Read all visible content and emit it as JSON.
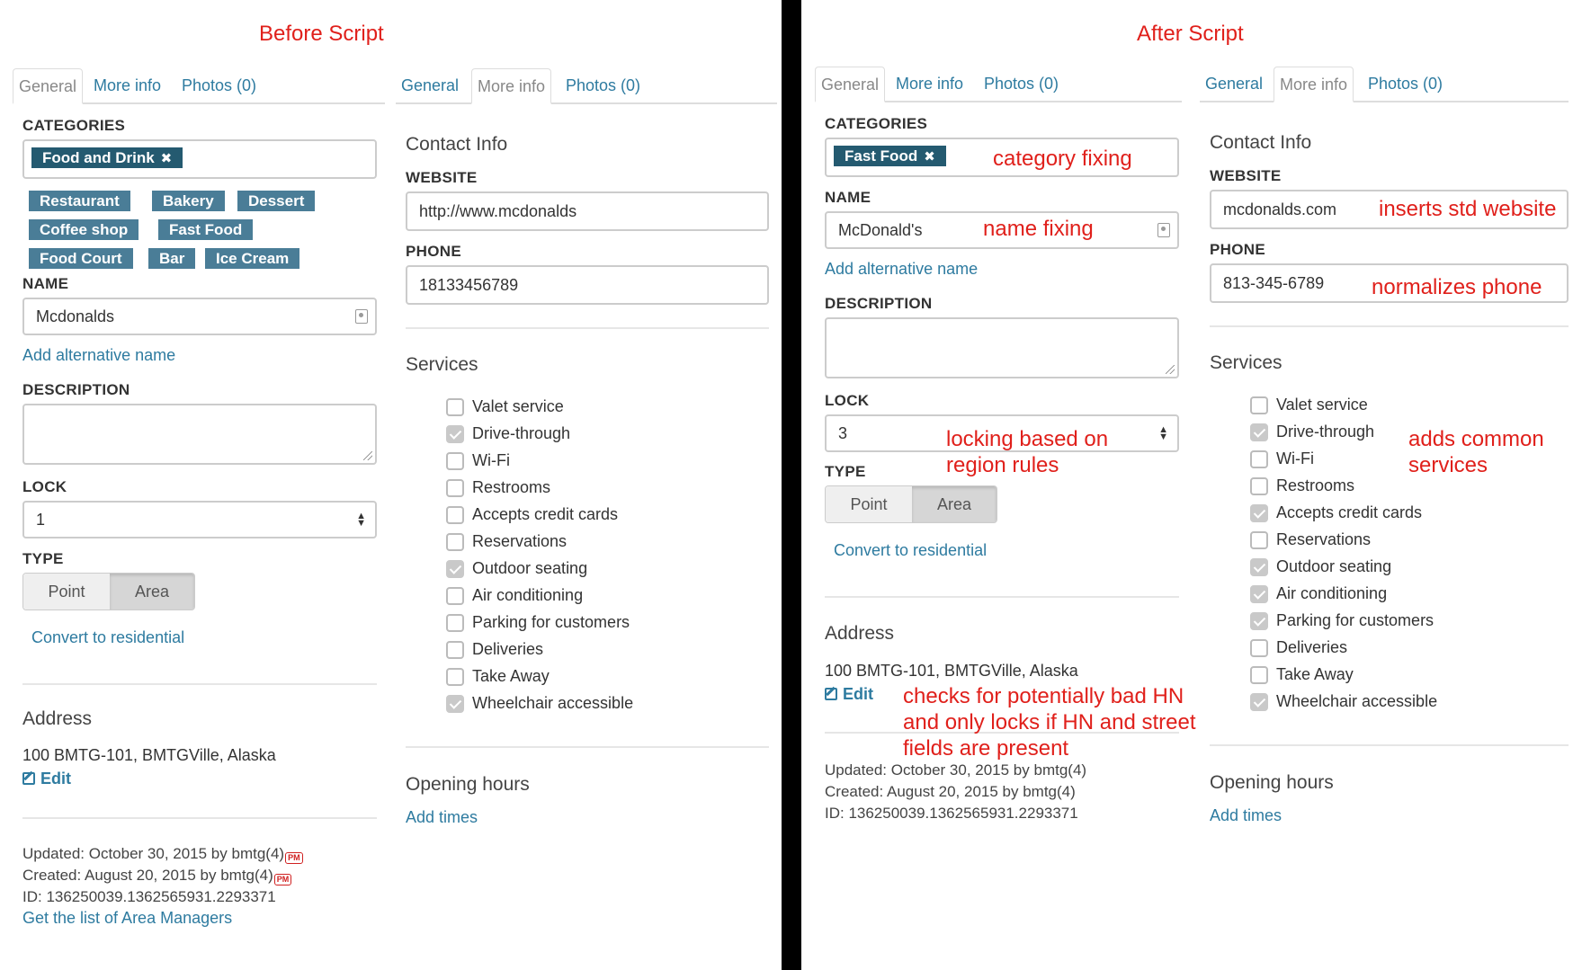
{
  "before": {
    "title": "Before Script",
    "general": {
      "tabs": [
        "General",
        "More info",
        "Photos (0)"
      ],
      "categories_label": "CATEGORIES",
      "selected_category": "Food and Drink",
      "suggestions": [
        "Restaurant",
        "Bakery",
        "Dessert",
        "Coffee shop",
        "Fast Food",
        "Food Court",
        "Bar",
        "Ice Cream"
      ],
      "name_label": "NAME",
      "name_value": "Mcdonalds",
      "add_alt_name": "Add alternative name",
      "description_label": "DESCRIPTION",
      "lock_label": "LOCK",
      "lock_value": "1",
      "type_label": "TYPE",
      "type_options": [
        "Point",
        "Area"
      ],
      "type_selected": "Area",
      "convert": "Convert to residential",
      "address_label": "Address",
      "address": "100 BMTG-101, BMTGVille, Alaska",
      "edit": "Edit",
      "updated": "Updated: October 30, 2015 by bmtg(4)",
      "created": "Created: August 20, 2015 by bmtg(4)",
      "pm": "PM",
      "id": "ID: 136250039.1362565931.2293371",
      "area_managers": "Get the list of Area Managers"
    },
    "more": {
      "tabs": [
        "General",
        "More info",
        "Photos (0)"
      ],
      "contact_heading": "Contact Info",
      "website_label": "WEBSITE",
      "website_value": "http://www.mcdonalds",
      "phone_label": "PHONE",
      "phone_value": "18133456789",
      "services_heading": "Services",
      "services": [
        {
          "label": "Valet service",
          "checked": false
        },
        {
          "label": "Drive-through",
          "checked": true
        },
        {
          "label": "Wi-Fi",
          "checked": false
        },
        {
          "label": "Restrooms",
          "checked": false
        },
        {
          "label": "Accepts credit cards",
          "checked": false
        },
        {
          "label": "Reservations",
          "checked": false
        },
        {
          "label": "Outdoor seating",
          "checked": true
        },
        {
          "label": "Air conditioning",
          "checked": false
        },
        {
          "label": "Parking for customers",
          "checked": false
        },
        {
          "label": "Deliveries",
          "checked": false
        },
        {
          "label": "Take Away",
          "checked": false
        },
        {
          "label": "Wheelchair accessible",
          "checked": true
        }
      ],
      "hours_heading": "Opening hours",
      "add_times": "Add times"
    }
  },
  "after": {
    "title": "After Script",
    "general": {
      "tabs": [
        "General",
        "More info",
        "Photos (0)"
      ],
      "categories_label": "CATEGORIES",
      "selected_category": "Fast Food",
      "name_label": "NAME",
      "name_value": "McDonald's",
      "add_alt_name": "Add alternative name",
      "description_label": "DESCRIPTION",
      "lock_label": "LOCK",
      "lock_value": "3",
      "type_label": "TYPE",
      "type_options": [
        "Point",
        "Area"
      ],
      "type_selected": "Area",
      "convert": "Convert to residential",
      "address_label": "Address",
      "address": "100 BMTG-101, BMTGVille, Alaska",
      "edit": "Edit",
      "updated": "Updated: October 30, 2015 by bmtg(4)",
      "created": "Created: August 20, 2015 by bmtg(4)",
      "id": "ID: 136250039.1362565931.2293371"
    },
    "more": {
      "tabs": [
        "General",
        "More info",
        "Photos (0)"
      ],
      "contact_heading": "Contact Info",
      "website_label": "WEBSITE",
      "website_value": "mcdonalds.com",
      "phone_label": "PHONE",
      "phone_value": "813-345-6789",
      "services_heading": "Services",
      "services": [
        {
          "label": "Valet service",
          "checked": false
        },
        {
          "label": "Drive-through",
          "checked": true
        },
        {
          "label": "Wi-Fi",
          "checked": false
        },
        {
          "label": "Restrooms",
          "checked": false
        },
        {
          "label": "Accepts credit cards",
          "checked": true
        },
        {
          "label": "Reservations",
          "checked": false
        },
        {
          "label": "Outdoor seating",
          "checked": true
        },
        {
          "label": "Air conditioning",
          "checked": true
        },
        {
          "label": "Parking for customers",
          "checked": true
        },
        {
          "label": "Deliveries",
          "checked": false
        },
        {
          "label": "Take Away",
          "checked": false
        },
        {
          "label": "Wheelchair accessible",
          "checked": true
        }
      ],
      "hours_heading": "Opening hours",
      "add_times": "Add times"
    },
    "annotations": {
      "category": "category fixing",
      "name": "name fixing",
      "lock_line1": "locking based on",
      "lock_line2": "region rules",
      "address_line1": "checks for potentially bad HN",
      "address_line2": "and only locks if HN and street",
      "address_line3": "fields are present",
      "website": "inserts std website",
      "phone": "normalizes phone",
      "services_line1": "adds common",
      "services_line2": "services"
    }
  },
  "colors": {
    "annotation": "#e0201b",
    "link": "#2e7ba0",
    "chip": "#4a7d97",
    "chip_selected": "#245a70"
  }
}
